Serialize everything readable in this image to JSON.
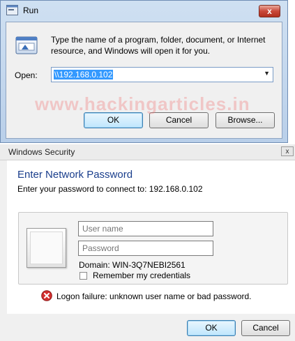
{
  "run_dialog": {
    "title": "Run",
    "close_label": "x",
    "description": "Type the name of a program, folder, document, or Internet resource, and Windows will open it for you.",
    "open_label": "Open:",
    "open_value": "\\\\192.168.0.102",
    "ok_label": "OK",
    "cancel_label": "Cancel",
    "browse_label": "Browse..."
  },
  "watermark": "www.hackingarticles.in",
  "security_dialog": {
    "title": "Windows Security",
    "close_label": "x",
    "heading": "Enter Network Password",
    "subtitle": "Enter your password to connect to: 192.168.0.102",
    "username_placeholder": "User name",
    "password_placeholder": "Password",
    "domain": "Domain: WIN-3Q7NEBI2561",
    "remember_label": "Remember my credentials",
    "remember_checked": false,
    "error_text": "Logon failure: unknown user name or bad password.",
    "ok_label": "OK",
    "cancel_label": "Cancel"
  },
  "colors": {
    "accent_blue": "#3399ff",
    "heading_blue": "#1a3e8c",
    "error_red": "#c62828"
  }
}
